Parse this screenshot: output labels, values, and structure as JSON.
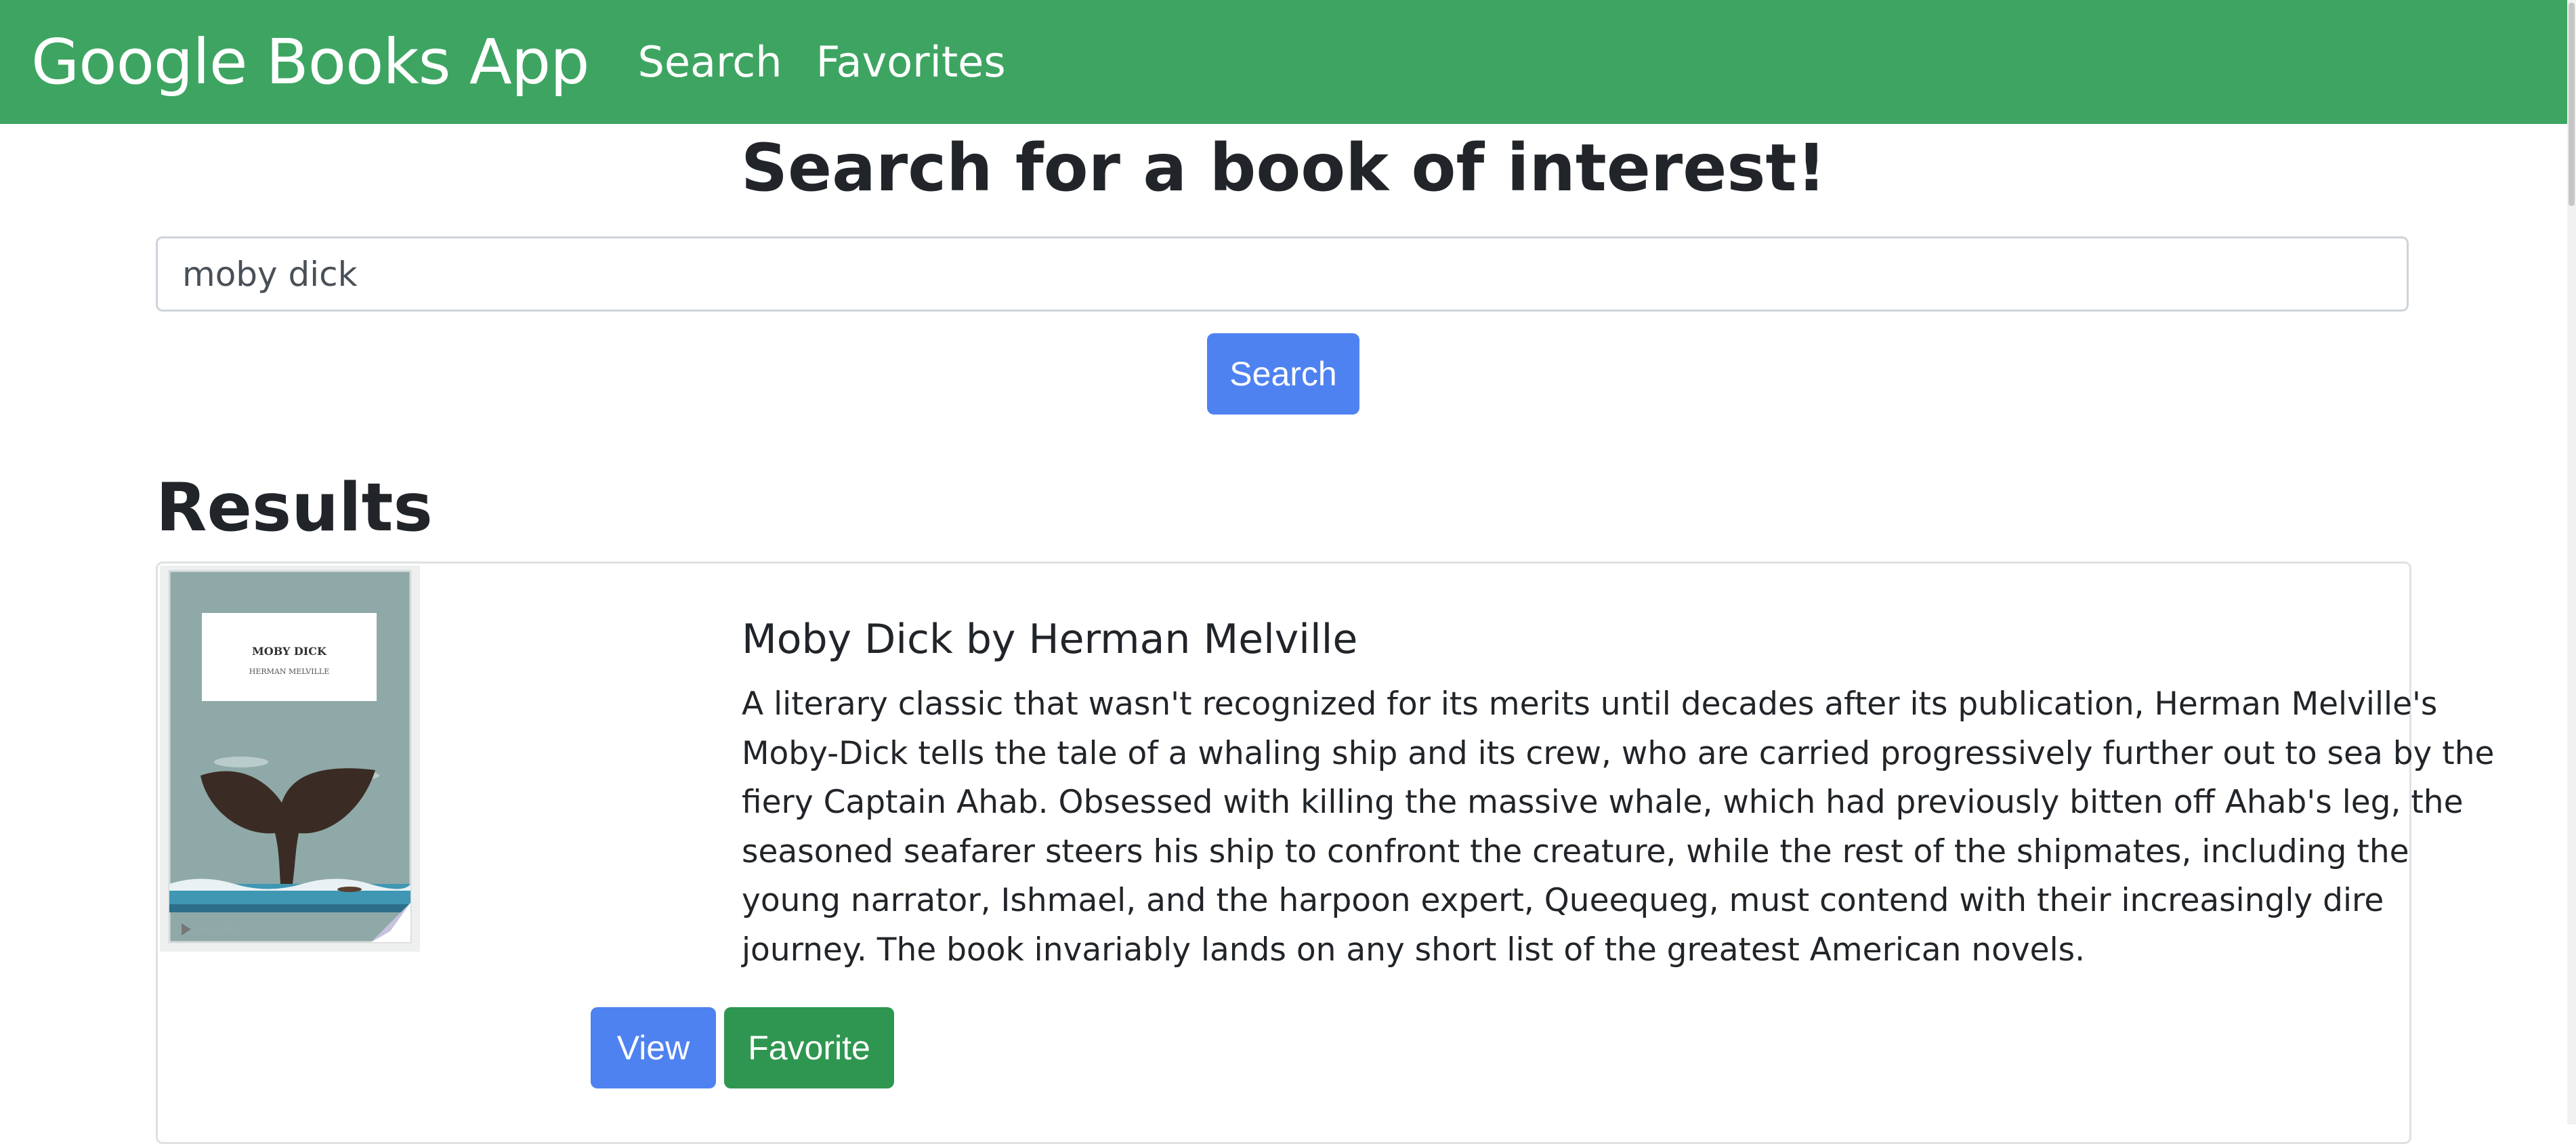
{
  "navbar": {
    "brand": "Google Books App",
    "links": [
      {
        "label": "Search"
      },
      {
        "label": "Favorites"
      }
    ]
  },
  "main": {
    "title": "Search for a book of interest!",
    "search": {
      "value": "moby dick",
      "placeholder": "",
      "button_label": "Search"
    },
    "results_heading": "Results",
    "results": [
      {
        "title": "Moby Dick by Herman Melville",
        "description": "A literary classic that wasn't recognized for its merits until decades after its publication, Herman Melville's Moby-Dick tells the tale of a whaling ship and its crew, who are carried progressively further out to sea by the fiery Captain Ahab. Obsessed with killing the massive whale, which had previously bitten off Ahab's leg, the seasoned seafarer steers his ship to confront the creature, while the rest of the shipmates, including the young narrator, Ishmael, and the harpoon expert, Queequeg, must contend with their increasingly dire journey. The book invariably lands on any short list of the greatest American novels.",
        "cover": {
          "title": "MOBY DICK",
          "author": "HERMAN MELVILLE",
          "badge": "Google Play"
        },
        "view_label": "View",
        "favorite_label": "Favorite"
      }
    ]
  },
  "colors": {
    "navbar": "#3da561",
    "primary": "#4e82f1",
    "success": "#2e9650"
  }
}
